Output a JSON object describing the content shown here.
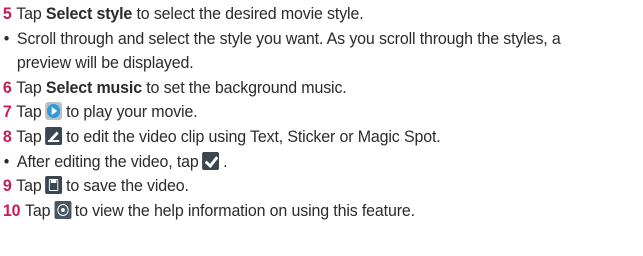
{
  "colors": {
    "step_number": "#c51e55",
    "body_text": "#2b2b2b",
    "play_icon_blue": "#2f9ad8",
    "icon_dark": "#3a4650"
  },
  "steps": {
    "s5": {
      "num": "5",
      "pre": "Tap ",
      "bold": "Select style",
      "post": " to select the desired movie style."
    },
    "b1": {
      "bullet": "•",
      "line1": "Scroll through and select the style you want. As you scroll through the styles, a",
      "line2": "preview will be displayed."
    },
    "s6": {
      "num": "6",
      "pre": "Tap ",
      "bold": "Select music",
      "post": " to set the background music."
    },
    "s7": {
      "num": "7",
      "pre": "Tap",
      "icon": "play-icon",
      "post": "to play your movie."
    },
    "s8": {
      "num": "8",
      "pre": "Tap",
      "icon": "edit-icon",
      "post": "to edit the video clip using Text, Sticker or Magic Spot."
    },
    "b2": {
      "bullet": "•",
      "pre": "After editing the video, tap",
      "icon": "checkmark-icon",
      "post": "."
    },
    "s9": {
      "num": "9",
      "pre": "Tap",
      "icon": "save-icon",
      "post": "to save the video."
    },
    "s10": {
      "num": "10",
      "pre": "Tap",
      "icon": "help-icon",
      "post": "to view the help information on using this feature."
    }
  }
}
